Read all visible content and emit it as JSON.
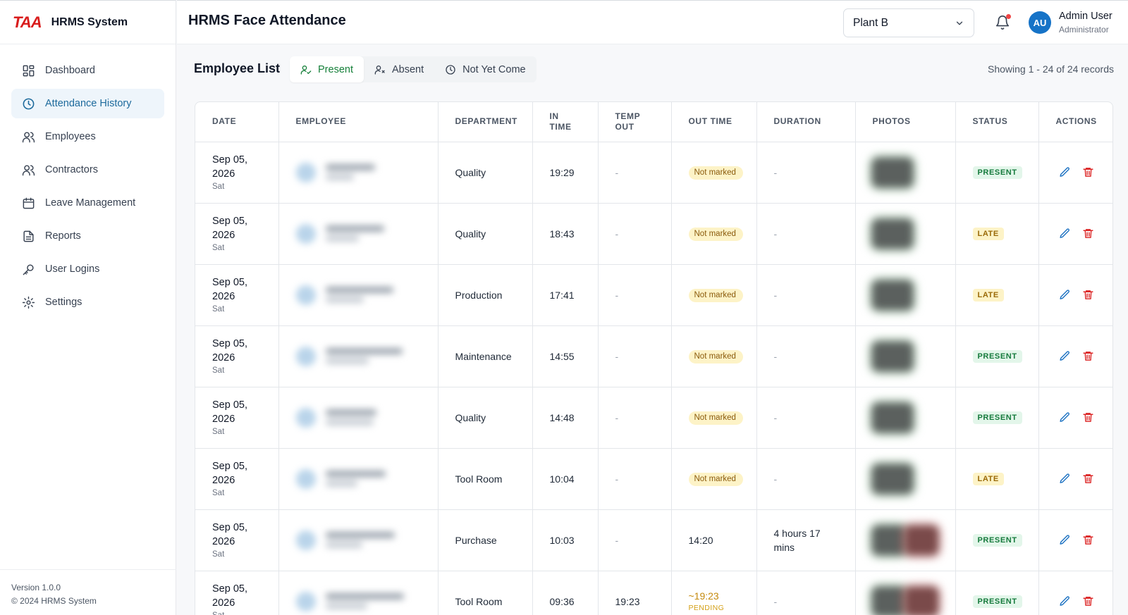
{
  "brand": {
    "logo": "TAA",
    "name": "HRMS System"
  },
  "sidebar": {
    "items": [
      {
        "label": "Dashboard",
        "icon": "dashboard-icon",
        "active": false
      },
      {
        "label": "Attendance History",
        "icon": "clock-icon",
        "active": true
      },
      {
        "label": "Employees",
        "icon": "users-icon",
        "active": false
      },
      {
        "label": "Contractors",
        "icon": "users-icon",
        "active": false
      },
      {
        "label": "Leave Management",
        "icon": "calendar-icon",
        "active": false
      },
      {
        "label": "Reports",
        "icon": "document-icon",
        "active": false
      },
      {
        "label": "User Logins",
        "icon": "key-icon",
        "active": false
      },
      {
        "label": "Settings",
        "icon": "gear-icon",
        "active": false
      }
    ],
    "version": "Version 1.0.0",
    "copyright": "© 2024 HRMS System"
  },
  "header": {
    "title": "HRMS Face Attendance",
    "plant": "Plant B",
    "user_initials": "AU",
    "user_name": "Admin User",
    "user_role": "Administrator"
  },
  "toolbar": {
    "list_title": "Employee List",
    "tabs": [
      {
        "label": "Present",
        "active": true
      },
      {
        "label": "Absent",
        "active": false
      },
      {
        "label": "Not Yet Come",
        "active": false
      }
    ],
    "showing": "Showing 1 - 24 of 24 records"
  },
  "table": {
    "headers": [
      "DATE",
      "EMPLOYEE",
      "DEPARTMENT",
      "IN TIME",
      "TEMP OUT",
      "OUT TIME",
      "DURATION",
      "PHOTOS",
      "STATUS",
      "ACTIONS"
    ],
    "rows": [
      {
        "date": "Sep 05, 2026",
        "day": "Sat",
        "department": "Quality",
        "in_time": "19:29",
        "temp_out": "-",
        "out_time": "Not marked",
        "out_kind": "not_marked",
        "duration": "-",
        "status": "PRESENT",
        "photos": 1
      },
      {
        "date": "Sep 05, 2026",
        "day": "Sat",
        "department": "Quality",
        "in_time": "18:43",
        "temp_out": "-",
        "out_time": "Not marked",
        "out_kind": "not_marked",
        "duration": "-",
        "status": "LATE",
        "photos": 1
      },
      {
        "date": "Sep 05, 2026",
        "day": "Sat",
        "department": "Production",
        "in_time": "17:41",
        "temp_out": "-",
        "out_time": "Not marked",
        "out_kind": "not_marked",
        "duration": "-",
        "status": "LATE",
        "photos": 1
      },
      {
        "date": "Sep 05, 2026",
        "day": "Sat",
        "department": "Maintenance",
        "in_time": "14:55",
        "temp_out": "-",
        "out_time": "Not marked",
        "out_kind": "not_marked",
        "duration": "-",
        "status": "PRESENT",
        "photos": 1
      },
      {
        "date": "Sep 05, 2026",
        "day": "Sat",
        "department": "Quality",
        "in_time": "14:48",
        "temp_out": "-",
        "out_time": "Not marked",
        "out_kind": "not_marked",
        "duration": "-",
        "status": "PRESENT",
        "photos": 1
      },
      {
        "date": "Sep 05, 2026",
        "day": "Sat",
        "department": "Tool Room",
        "in_time": "10:04",
        "temp_out": "-",
        "out_time": "Not marked",
        "out_kind": "not_marked",
        "duration": "-",
        "status": "LATE",
        "photos": 1
      },
      {
        "date": "Sep 05, 2026",
        "day": "Sat",
        "department": "Purchase",
        "in_time": "10:03",
        "temp_out": "-",
        "out_time": "14:20",
        "out_kind": "time",
        "duration": "4 hours 17 mins",
        "status": "PRESENT",
        "photos": 2
      },
      {
        "date": "Sep 05, 2026",
        "day": "Sat",
        "department": "Tool Room",
        "in_time": "09:36",
        "temp_out": "19:23",
        "out_time": "~19:23",
        "out_kind": "pending",
        "pending_label": "PENDING",
        "duration": "-",
        "status": "PRESENT",
        "photos": 2
      }
    ]
  },
  "colors": {
    "accent": "#1d6a9c",
    "present_green": "#16803a",
    "danger": "#dc2626",
    "avatar_blue": "#1673c7"
  }
}
